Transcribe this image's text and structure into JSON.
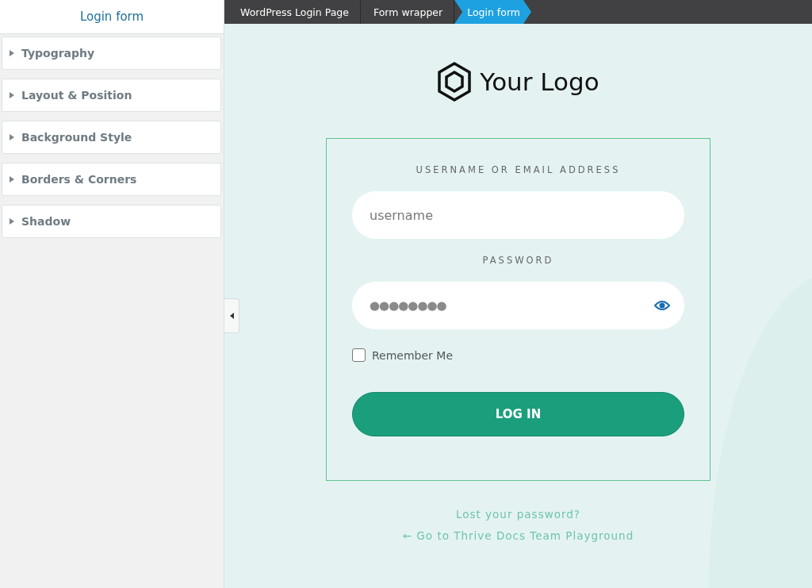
{
  "sidebar": {
    "title": "Login form",
    "sections": [
      {
        "label": "Typography",
        "expanded": false
      },
      {
        "label": "Layout & Position",
        "expanded": false
      },
      {
        "label": "Background Style",
        "expanded": false
      },
      {
        "label": "Borders & Corners",
        "expanded": false
      },
      {
        "label": "Shadow",
        "expanded": false
      }
    ]
  },
  "breadcrumbs": [
    {
      "label": "WordPress Login Page",
      "selected": false
    },
    {
      "label": "Form wrapper",
      "selected": false
    },
    {
      "label": "Login form",
      "selected": true
    }
  ],
  "logo": {
    "text": "Your Logo"
  },
  "form": {
    "username_label": "USERNAME OR EMAIL ADDRESS",
    "username": {
      "placeholder": "username"
    },
    "password_label": "PASSWORD",
    "password": {
      "value": "●●●●●●●●"
    },
    "remember": {
      "label": "Remember Me",
      "checked": false
    },
    "submit": "LOG IN"
  },
  "links": [
    "Lost your password?",
    "← Go to Thrive Docs Team Playground"
  ]
}
